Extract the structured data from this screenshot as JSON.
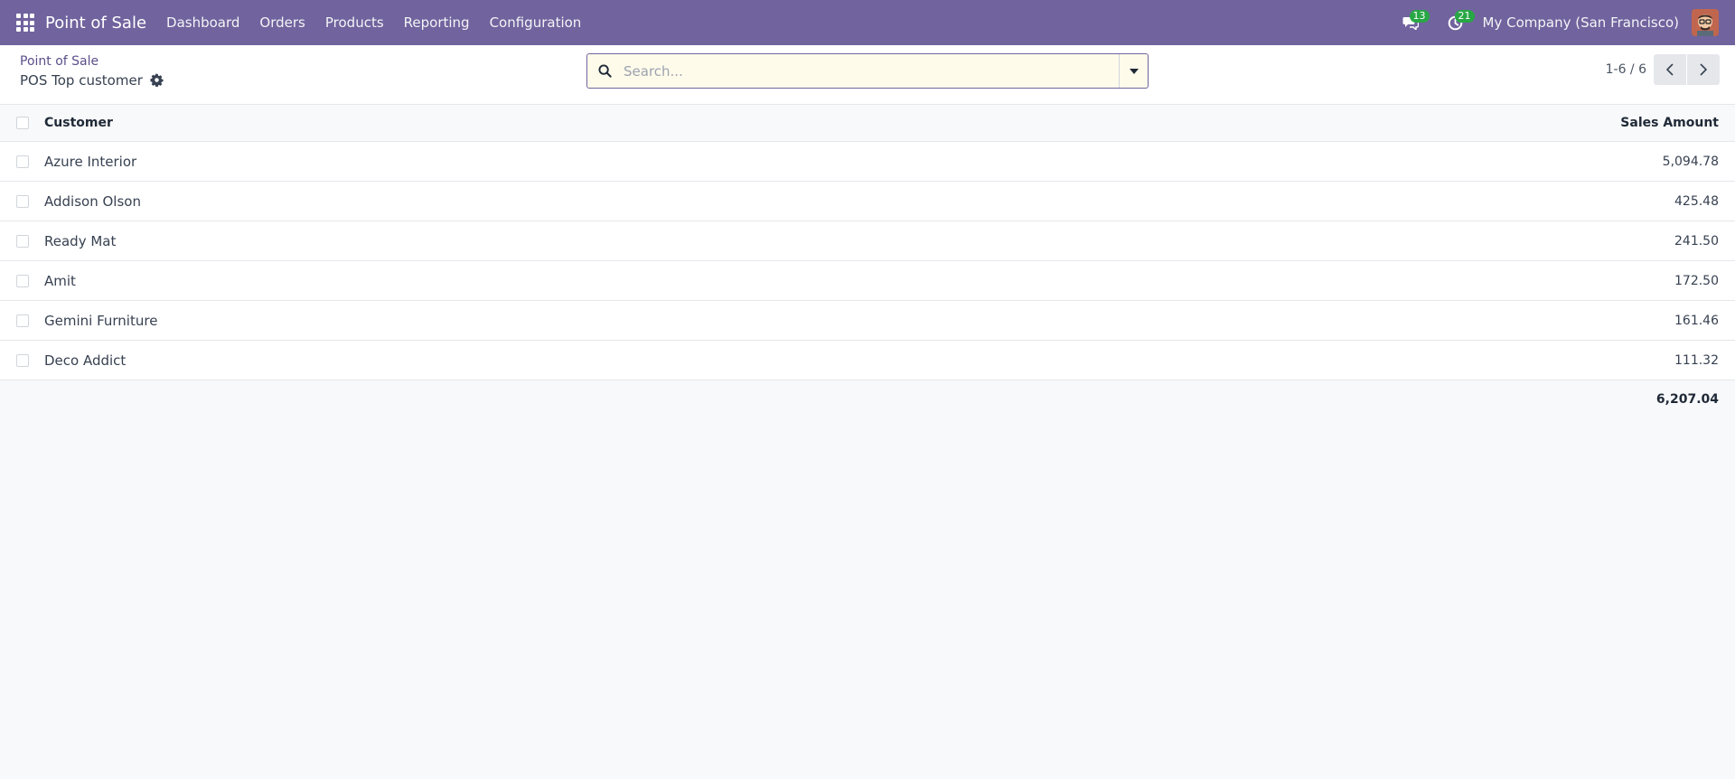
{
  "navbar": {
    "brand": "Point of Sale",
    "menu": [
      "Dashboard",
      "Orders",
      "Products",
      "Reporting",
      "Configuration"
    ],
    "messages_count": "13",
    "activities_count": "21",
    "company": "My Company (San Francisco)",
    "bg_color": "#71639e"
  },
  "breadcrumb": {
    "parent": "Point of Sale",
    "current": "POS Top customer"
  },
  "search": {
    "placeholder": "Search..."
  },
  "pager": {
    "value": "1-6 / 6"
  },
  "table": {
    "columns": [
      "Customer",
      "Sales Amount"
    ],
    "rows": [
      {
        "customer": "Azure Interior",
        "amount": "5,094.78"
      },
      {
        "customer": "Addison Olson",
        "amount": "425.48"
      },
      {
        "customer": "Ready Mat",
        "amount": "241.50"
      },
      {
        "customer": "Amit",
        "amount": "172.50"
      },
      {
        "customer": "Gemini Furniture",
        "amount": "161.46"
      },
      {
        "customer": "Deco Addict",
        "amount": "111.32"
      }
    ],
    "total": "6,207.04"
  }
}
